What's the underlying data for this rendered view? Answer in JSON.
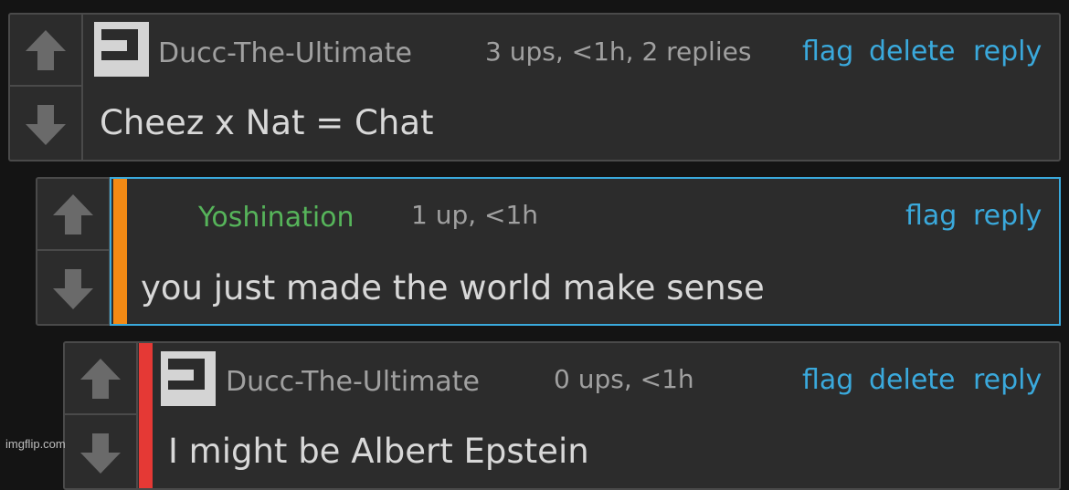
{
  "comments": [
    {
      "username": "Ducc-The-Ultimate",
      "meta": "3 ups, <1h, 2 replies",
      "actions": {
        "flag": "flag",
        "delete": "delete",
        "reply": "reply"
      },
      "text": "Cheez x Nat = Chat"
    },
    {
      "username": "Yoshination",
      "meta": "1 up, <1h",
      "actions": {
        "flag": "flag",
        "reply": "reply"
      },
      "text": "you just made the world make sense",
      "stripe_color": "#f28a15"
    },
    {
      "username": "Ducc-The-Ultimate",
      "meta": "0 ups, <1h",
      "actions": {
        "flag": "flag",
        "delete": "delete",
        "reply": "reply"
      },
      "text": "I might be Albert Epstein",
      "stripe_color": "#e53935"
    }
  ],
  "watermark": "imgflip.com",
  "colors": {
    "link": "#3aa9dc",
    "username_green": "#56b45a",
    "highlight_border": "#3aa9dc"
  }
}
